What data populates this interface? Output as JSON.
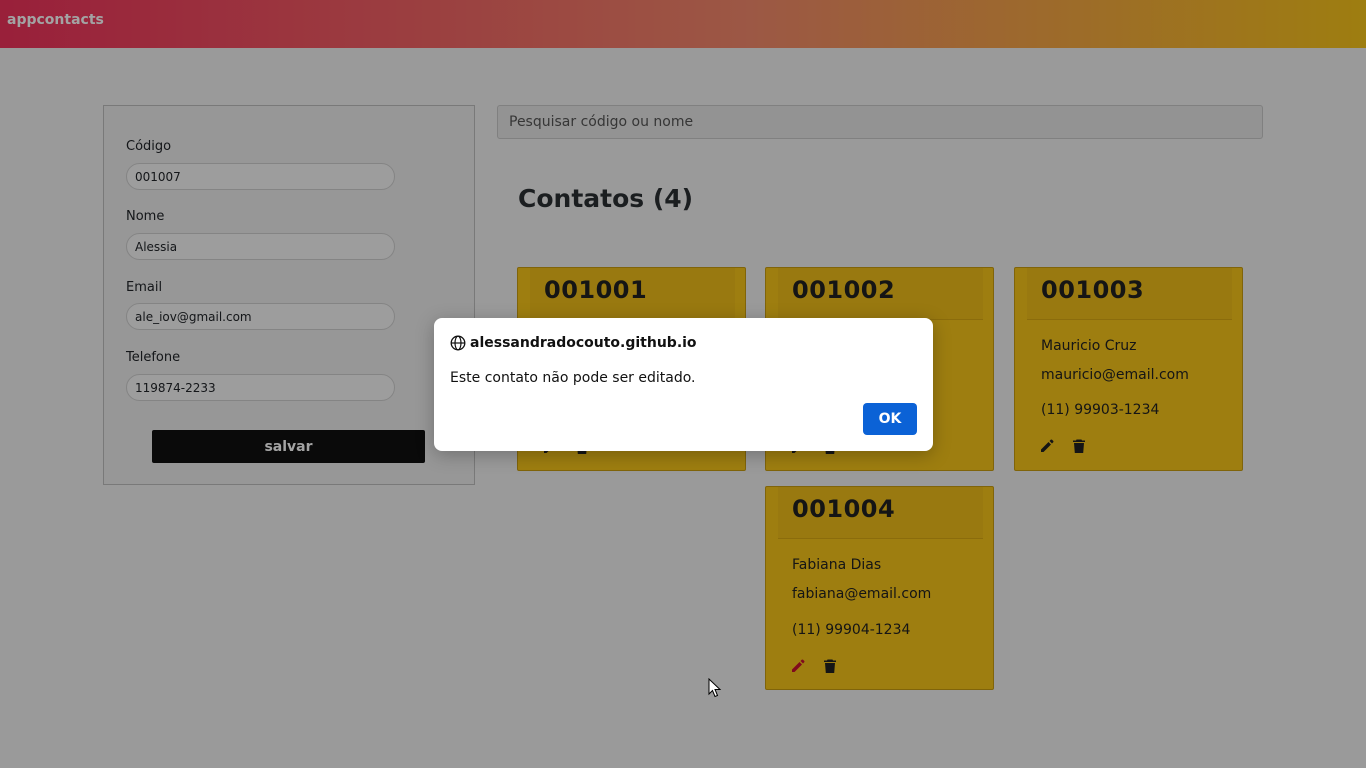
{
  "navbar": {
    "brand": "appcontacts"
  },
  "form": {
    "fields": [
      {
        "label": "Código",
        "value": "001007"
      },
      {
        "label": "Nome",
        "value": "Alessia"
      },
      {
        "label": "Email",
        "value": "ale_iov@gmail.com"
      },
      {
        "label": "Telefone",
        "value": "119874-2233"
      }
    ],
    "save_label": "salvar"
  },
  "search": {
    "placeholder": "Pesquisar código ou nome"
  },
  "list": {
    "title": "Contatos (4)",
    "contacts": [
      {
        "code": "001001",
        "name": "",
        "email": "",
        "phone": ""
      },
      {
        "code": "001002",
        "name": "",
        "email": "",
        "phone": ""
      },
      {
        "code": "001003",
        "name": "Mauricio Cruz",
        "email": "mauricio@email.com",
        "phone": "(11) 99903-1234"
      },
      {
        "code": "001004",
        "name": "Fabiana Dias",
        "email": "fabiana@email.com",
        "phone": "(11) 99904-1234"
      }
    ]
  },
  "dialog": {
    "origin": "alessandradocouto.github.io",
    "message": "Este contato não pode ser editado.",
    "ok_label": "OK"
  },
  "icons": {
    "edit": "pencil-icon",
    "delete": "trash-icon",
    "origin": "globe-icon"
  },
  "colors": {
    "card": "#f7c51a",
    "ok_button": "#0b62d6",
    "edit_active": "#c8102e"
  }
}
